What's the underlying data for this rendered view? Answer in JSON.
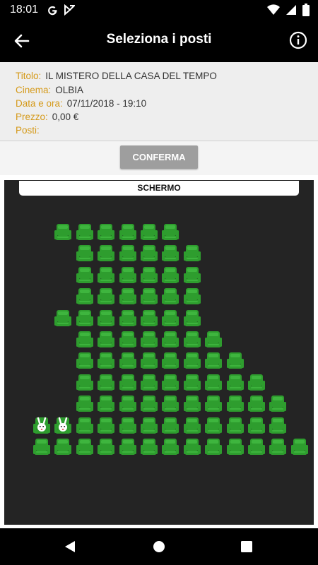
{
  "status_bar": {
    "time": "18:01",
    "left_icons": [
      "google-icon",
      "app-notification-icon"
    ],
    "right_icons": [
      "wifi-icon",
      "signal-icon",
      "battery-icon"
    ]
  },
  "app_bar": {
    "title": "Seleziona i posti",
    "back_icon": "arrow-left-icon",
    "info_icon": "info-circle-icon"
  },
  "details": {
    "title_label": "Titolo:",
    "title_value": "IL MISTERO DELLA CASA DEL TEMPO",
    "cinema_label": "Cinema:",
    "cinema_value": "OLBIA",
    "datetime_label": "Data e ora:",
    "datetime_value": "07/11/2018 - 19:10",
    "price_label": "Prezzo:",
    "price_value": "0,00 €",
    "seats_label": "Posti:",
    "seats_value": ""
  },
  "confirm_label": "CONFERMA",
  "screen_label": "SCHERMO",
  "colors": {
    "seat_available": "#2e9d2e",
    "seat_available_light": "#4cc94c",
    "seat_reserved": "#ffffff",
    "label_accent": "#d59a1a",
    "hall_background": "#242424"
  },
  "seat_map": {
    "legend": {
      "A": "available",
      "R": "reserved"
    },
    "rows": [
      [
        "",
        "A",
        "A",
        "A",
        "A",
        "A",
        "A",
        "",
        "",
        "",
        "",
        "",
        "",
        ""
      ],
      [
        "",
        "",
        "A",
        "A",
        "A",
        "A",
        "A",
        "A",
        "",
        "",
        "",
        "",
        "",
        ""
      ],
      [
        "",
        "",
        "A",
        "A",
        "A",
        "A",
        "A",
        "A",
        "",
        "",
        "",
        "",
        "",
        ""
      ],
      [
        "",
        "",
        "A",
        "A",
        "A",
        "A",
        "A",
        "A",
        "",
        "",
        "",
        "",
        "",
        ""
      ],
      [
        "",
        "A",
        "A",
        "A",
        "A",
        "A",
        "A",
        "A",
        "",
        "",
        "",
        "",
        "",
        ""
      ],
      [
        "",
        "",
        "A",
        "A",
        "A",
        "A",
        "A",
        "A",
        "A",
        "",
        "",
        "",
        "",
        ""
      ],
      [
        "",
        "",
        "A",
        "A",
        "A",
        "A",
        "A",
        "A",
        "A",
        "A",
        "",
        "",
        "",
        ""
      ],
      [
        "",
        "",
        "A",
        "A",
        "A",
        "A",
        "A",
        "A",
        "A",
        "A",
        "A",
        "",
        "",
        ""
      ],
      [
        "",
        "",
        "A",
        "A",
        "A",
        "A",
        "A",
        "A",
        "A",
        "A",
        "A",
        "A",
        "",
        ""
      ],
      [
        "R",
        "R",
        "A",
        "A",
        "A",
        "A",
        "A",
        "A",
        "A",
        "A",
        "A",
        "A",
        "",
        ""
      ],
      [
        "A",
        "A",
        "A",
        "A",
        "A",
        "A",
        "A",
        "A",
        "A",
        "A",
        "A",
        "A",
        "A",
        ""
      ]
    ]
  },
  "nav_bar": [
    "back-triangle-icon",
    "home-circle-icon",
    "recents-square-icon"
  ]
}
